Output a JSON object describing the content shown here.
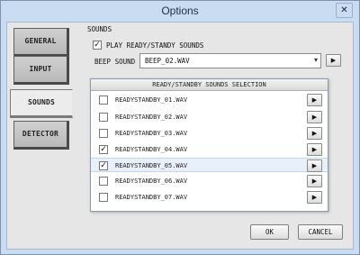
{
  "window": {
    "title": "Options",
    "close_glyph": "✕"
  },
  "tabs": [
    {
      "label": "GENERAL",
      "active": false
    },
    {
      "label": "INPUT",
      "active": false
    },
    {
      "label": "SOUNDS",
      "active": true
    },
    {
      "label": "DETECTOR",
      "active": false
    }
  ],
  "sounds": {
    "section_title": "SOUNDS",
    "play_ready_label": "PLAY READY/STANDY SOUNDS",
    "play_ready_checked": true,
    "beep_label": "BEEP SOUND",
    "beep_value": "BEEP_02.WAV",
    "play_glyph": "▶",
    "check_glyph": "✓",
    "list_title": "READY/STANDBY SOUNDS SELECTION",
    "files": [
      {
        "name": "READYSTANDBY_01.WAV",
        "checked": false,
        "selected": false
      },
      {
        "name": "READYSTANDBY_02.WAV",
        "checked": false,
        "selected": false
      },
      {
        "name": "READYSTANDBY_03.WAV",
        "checked": false,
        "selected": false
      },
      {
        "name": "READYSTANDBY_04.WAV",
        "checked": true,
        "selected": false
      },
      {
        "name": "READYSTANDBY_05.WAV",
        "checked": true,
        "selected": true
      },
      {
        "name": "READYSTANDBY_06.WAV",
        "checked": false,
        "selected": false
      },
      {
        "name": "READYSTANDBY_07.WAV",
        "checked": false,
        "selected": false
      }
    ]
  },
  "buttons": {
    "ok": "OK",
    "cancel": "CANCEL"
  }
}
